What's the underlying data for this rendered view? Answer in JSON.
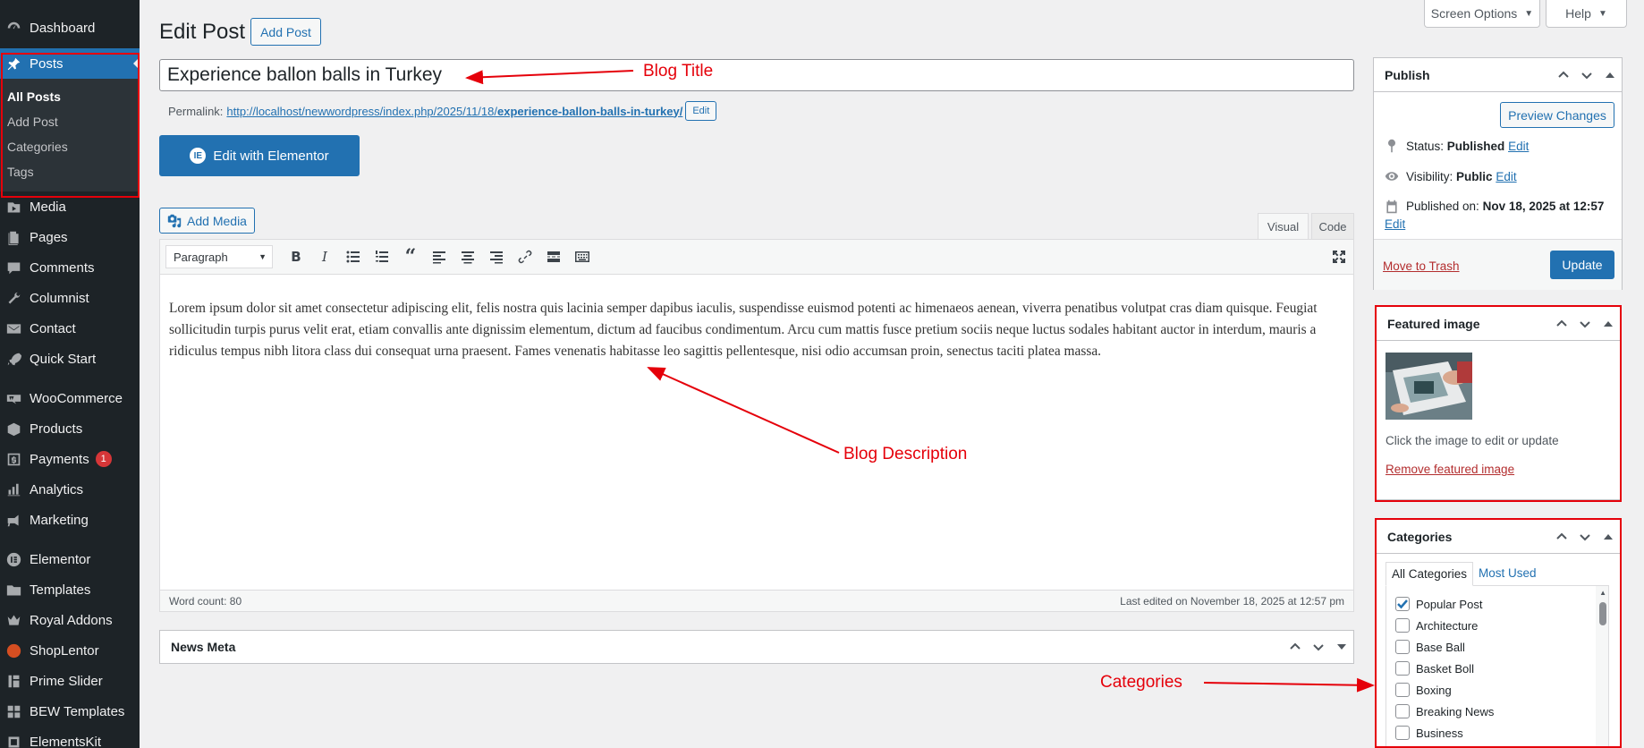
{
  "sidebar": {
    "items": [
      {
        "label": "Dashboard",
        "icon": "dashboard-icon"
      },
      {
        "label": "Posts",
        "icon": "pin-icon",
        "active": true
      },
      {
        "label": "Media",
        "icon": "media-icon"
      },
      {
        "label": "Pages",
        "icon": "pages-icon"
      },
      {
        "label": "Comments",
        "icon": "comments-icon"
      },
      {
        "label": "Columnist",
        "icon": "wrench-icon"
      },
      {
        "label": "Contact",
        "icon": "mail-icon"
      },
      {
        "label": "Quick Start",
        "icon": "rocket-icon"
      },
      {
        "label": "WooCommerce",
        "icon": "woocommerce-icon"
      },
      {
        "label": "Products",
        "icon": "products-icon"
      },
      {
        "label": "Payments",
        "icon": "payments-icon",
        "badge": "1"
      },
      {
        "label": "Analytics",
        "icon": "analytics-icon"
      },
      {
        "label": "Marketing",
        "icon": "megaphone-icon"
      },
      {
        "label": "Elementor",
        "icon": "elementor-icon"
      },
      {
        "label": "Templates",
        "icon": "folder-icon"
      },
      {
        "label": "Royal Addons",
        "icon": "crown-icon"
      },
      {
        "label": "ShopLentor",
        "icon": "shoplentor-icon"
      },
      {
        "label": "Prime Slider",
        "icon": "slider-icon"
      },
      {
        "label": "BEW Templates",
        "icon": "grid-icon"
      },
      {
        "label": "ElementsKit",
        "icon": "elementskit-icon"
      }
    ],
    "submenu": [
      "All Posts",
      "Add Post",
      "Categories",
      "Tags"
    ]
  },
  "header": {
    "title": "Edit Post",
    "add_post": "Add Post",
    "screen_options": "Screen Options",
    "help": "Help"
  },
  "post": {
    "title": "Experience ballon balls in Turkey",
    "permalink_label": "Permalink:",
    "permalink_base": "http://localhost/newwordpress/index.php/2025/11/18/",
    "permalink_slug": "experience-ballon-balls-in-turkey/",
    "edit_slug": "Edit",
    "elementor_button": "Edit with Elementor",
    "add_media": "Add Media",
    "tab_visual": "Visual",
    "tab_code": "Code",
    "format": "Paragraph",
    "content": "Lorem ipsum dolor sit amet consectetur adipiscing elit, felis nostra quis lacinia semper dapibus iaculis, suspendisse euismod potenti ac himenaeos aenean, viverra penatibus volutpat cras diam quisque. Feugiat sollicitudin turpis purus velit erat, etiam convallis ante dignissim elementum, dictum ad faucibus condimentum. Arcu cum mattis fusce pretium sociis neque luctus sodales habitant auctor in interdum, mauris a ridiculus tempus nibh litora class dui consequat urna praesent. Fames venenatis habitasse leo sagittis pellentesque, nisi odio accumsan proin, senectus taciti platea massa.",
    "word_count": "Word count: 80",
    "last_edited": "Last edited on November 18, 2025 at 12:57 pm"
  },
  "news_meta": {
    "title": "News Meta"
  },
  "publish": {
    "title": "Publish",
    "preview": "Preview Changes",
    "status_label": "Status:",
    "status_value": "Published",
    "visibility_label": "Visibility:",
    "visibility_value": "Public",
    "published_label": "Published on:",
    "published_value": "Nov 18, 2025 at 12:57",
    "edit": "Edit",
    "trash": "Move to Trash",
    "update": "Update"
  },
  "featured": {
    "title": "Featured image",
    "hint": "Click the image to edit or update",
    "remove": "Remove featured image"
  },
  "categories": {
    "title": "Categories",
    "tab_all": "All Categories",
    "tab_most": "Most Used",
    "items": [
      {
        "label": "Popular Post",
        "checked": true
      },
      {
        "label": "Architecture",
        "checked": false
      },
      {
        "label": "Base Ball",
        "checked": false
      },
      {
        "label": "Basket Boll",
        "checked": false
      },
      {
        "label": "Boxing",
        "checked": false
      },
      {
        "label": "Breaking News",
        "checked": false
      },
      {
        "label": "Business",
        "checked": false
      }
    ]
  },
  "annotations": {
    "blog_title": "Blog Title",
    "blog_description": "Blog Description",
    "categories": "Categories"
  },
  "colors": {
    "accent": "#2271b1",
    "annotation": "#e5000a",
    "sidebar": "#1d2327"
  }
}
